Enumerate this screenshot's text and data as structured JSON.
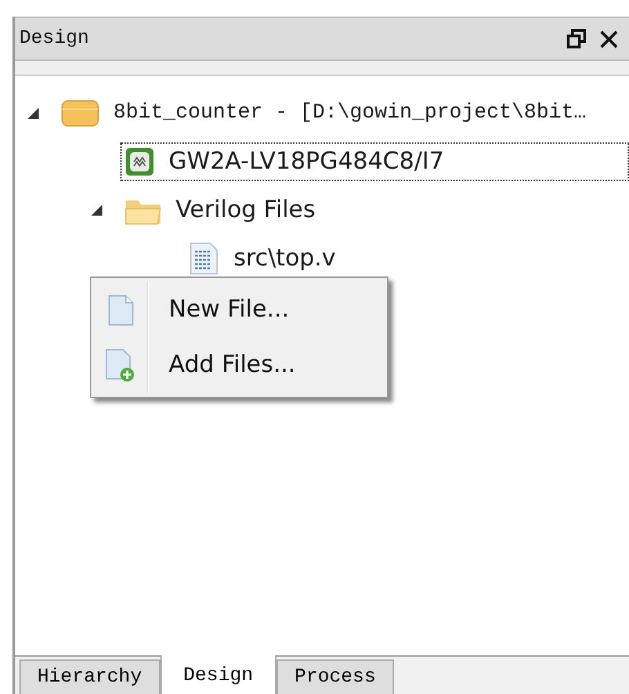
{
  "panel": {
    "title": "Design"
  },
  "tree": [
    {
      "label": "8bit_counter - [D:\\gowin_project\\8bit…",
      "kind": "project",
      "expanded": true,
      "focused": false,
      "children": [
        {
          "label": "GW2A-LV18PG484C8/I7",
          "kind": "device",
          "focused": true
        },
        {
          "label": "Verilog Files",
          "kind": "folder",
          "expanded": true,
          "focused": false,
          "children": [
            {
              "label": "src\\top.v",
              "kind": "file",
              "focused": false
            }
          ]
        }
      ]
    }
  ],
  "context_menu": [
    {
      "label": "New File...",
      "kind": "new"
    },
    {
      "label": "Add Files...",
      "kind": "add"
    }
  ],
  "tabs": [
    {
      "label": "Hierarchy",
      "selected": false
    },
    {
      "label": "Design",
      "selected": true
    },
    {
      "label": "Process",
      "selected": false
    }
  ]
}
